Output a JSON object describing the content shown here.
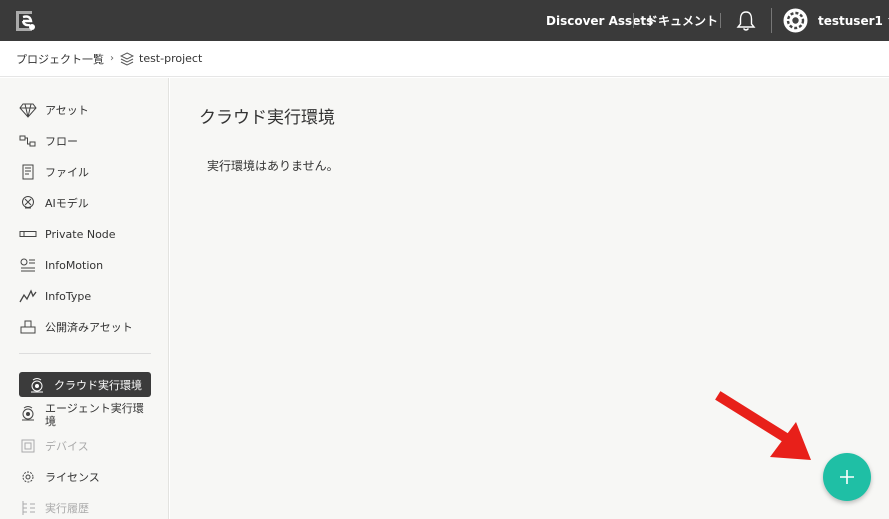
{
  "header": {
    "discover_label": "Discover Assets",
    "docs_label": "ドキュメント",
    "username": "testuser1"
  },
  "breadcrumb": {
    "projects": "プロジェクト一覧",
    "separator": "›",
    "current": "test-project"
  },
  "sidebar": {
    "items": [
      {
        "label": "アセット",
        "icon": "diamond-icon"
      },
      {
        "label": "フロー",
        "icon": "flow-icon"
      },
      {
        "label": "ファイル",
        "icon": "file-icon"
      },
      {
        "label": "AIモデル",
        "icon": "ai-model-icon"
      },
      {
        "label": "Private Node",
        "icon": "private-node-icon"
      },
      {
        "label": "InfoMotion",
        "icon": "infomotion-icon"
      },
      {
        "label": "InfoType",
        "icon": "infotype-icon"
      },
      {
        "label": "公開済みアセット",
        "icon": "published-assets-icon"
      },
      {
        "label": "クラウド実行環境",
        "icon": "cloud-env-icon",
        "active": true
      },
      {
        "label": "エージェント実行環境",
        "icon": "agent-env-icon"
      },
      {
        "label": "デバイス",
        "icon": "device-icon",
        "disabled": true
      },
      {
        "label": "ライセンス",
        "icon": "license-icon"
      },
      {
        "label": "実行履歴",
        "icon": "history-icon",
        "disabled": true
      }
    ]
  },
  "main": {
    "title": "クラウド実行環境",
    "empty_message": "実行環境はありません。"
  },
  "colors": {
    "header_bg": "#3a3a3a",
    "fab": "#1fbfa5",
    "active_item": "#3b3b3b",
    "arrow": "#e8201a"
  }
}
